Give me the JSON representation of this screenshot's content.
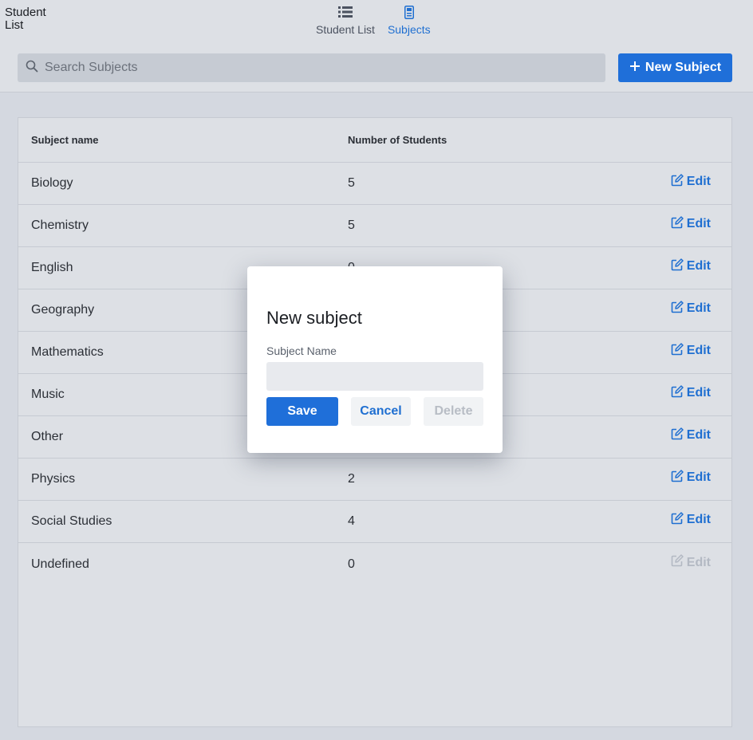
{
  "app": {
    "title": "Student List"
  },
  "nav": {
    "tabs": [
      {
        "label": "Student List",
        "icon": "list-icon",
        "active": false
      },
      {
        "label": "Subjects",
        "icon": "book-icon",
        "active": true
      }
    ]
  },
  "search": {
    "placeholder": "Search Subjects",
    "value": ""
  },
  "toolbar": {
    "new_subject_label": "New Subject"
  },
  "table": {
    "columns": [
      "Subject name",
      "Number of Students",
      ""
    ],
    "edit_label": "Edit",
    "rows": [
      {
        "name": "Biology",
        "count": "5",
        "editable": true
      },
      {
        "name": "Chemistry",
        "count": "5",
        "editable": true
      },
      {
        "name": "English",
        "count": "0",
        "editable": true
      },
      {
        "name": "Geography",
        "count": "",
        "editable": true
      },
      {
        "name": "Mathematics",
        "count": "",
        "editable": true
      },
      {
        "name": "Music",
        "count": "",
        "editable": true
      },
      {
        "name": "Other",
        "count": "",
        "editable": true
      },
      {
        "name": "Physics",
        "count": "2",
        "editable": true
      },
      {
        "name": "Social Studies",
        "count": "4",
        "editable": true
      },
      {
        "name": "Undefined",
        "count": "0",
        "editable": false
      }
    ]
  },
  "modal": {
    "title": "New subject",
    "field_label": "Subject Name",
    "field_value": "",
    "save_label": "Save",
    "cancel_label": "Cancel",
    "delete_label": "Delete"
  },
  "colors": {
    "accent": "#1f6fd9",
    "page_bg": "#d4d8e0",
    "header_bg": "#dde0e5",
    "disabled": "#b3b9c3"
  }
}
